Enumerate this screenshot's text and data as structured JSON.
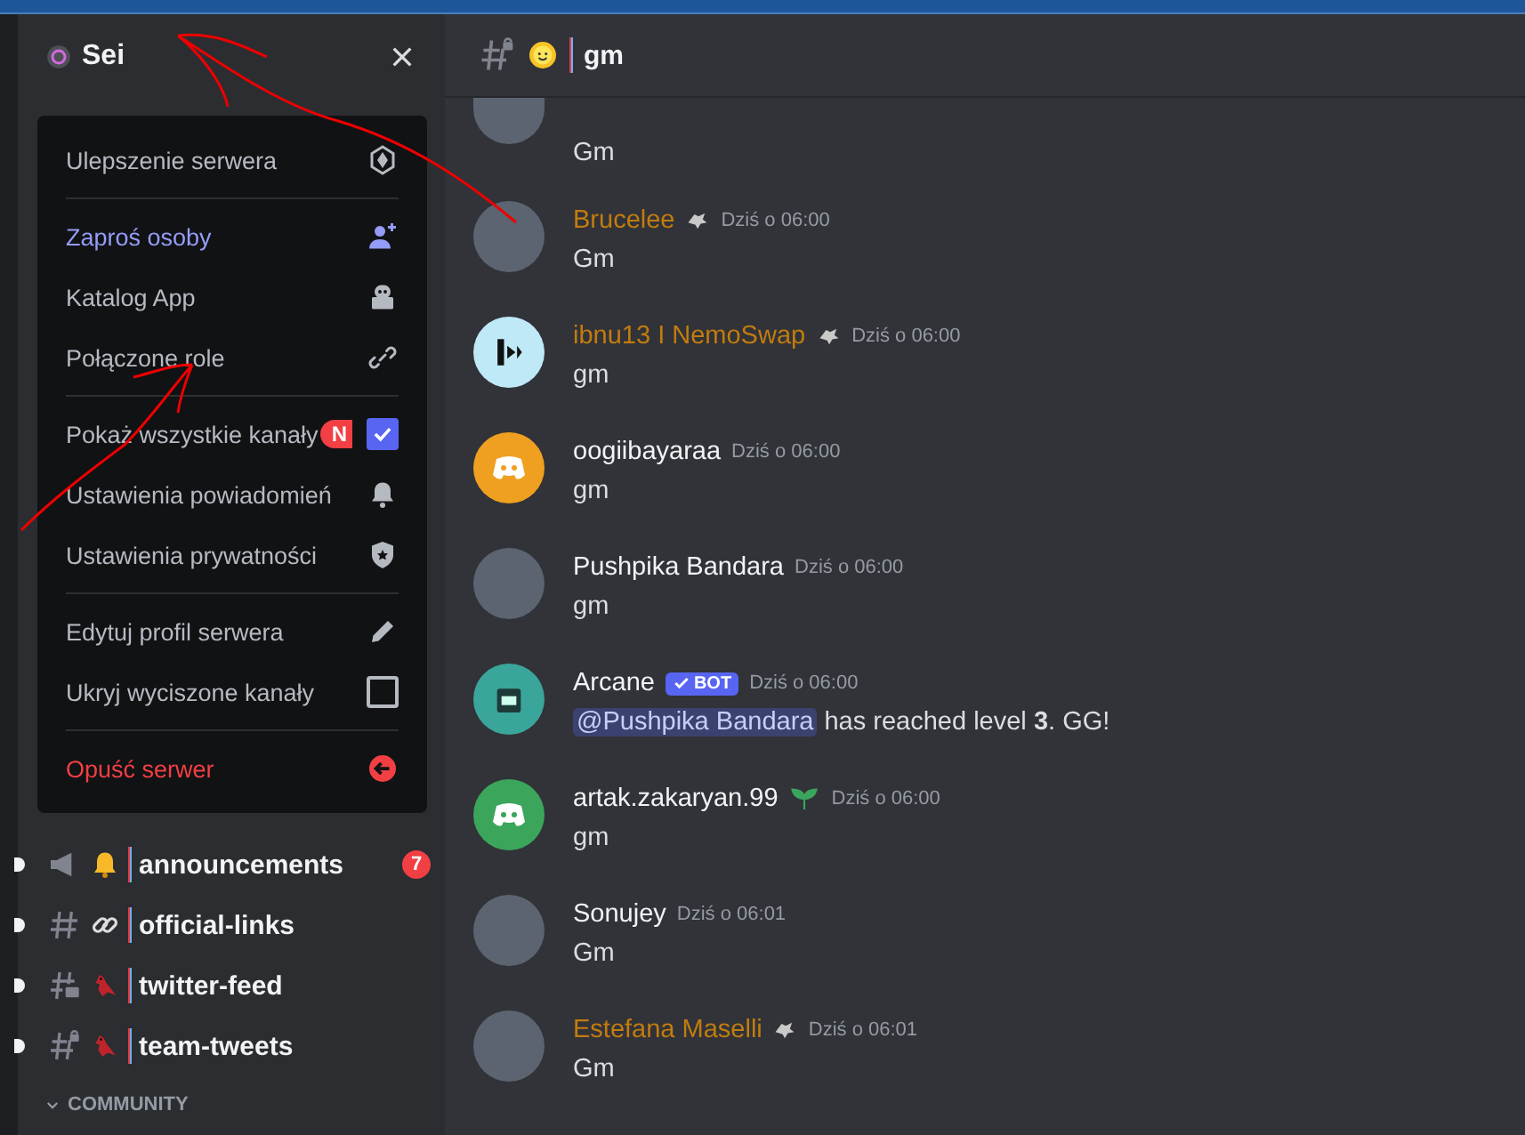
{
  "server": {
    "name": "Sei"
  },
  "menu_sections": [
    {
      "items": [
        {
          "label": "Ulepszenie serwera",
          "kind": "normal"
        }
      ]
    },
    {
      "items": [
        {
          "label": "Zaproś osoby",
          "kind": "accent"
        },
        {
          "label": "Katalog App",
          "kind": "normal"
        },
        {
          "label": "Połączone role",
          "kind": "normal"
        }
      ]
    },
    {
      "items": [
        {
          "label": "Pokaż wszystkie kanały",
          "kind": "normal",
          "checked": true,
          "badge": "N"
        },
        {
          "label": "Ustawienia powiadomień",
          "kind": "normal"
        },
        {
          "label": "Ustawienia prywatności",
          "kind": "normal"
        }
      ]
    },
    {
      "items": [
        {
          "label": "Edytuj profil serwera",
          "kind": "normal"
        },
        {
          "label": "Ukryj wyciszone kanały",
          "kind": "normal",
          "checked": false
        }
      ]
    },
    {
      "items": [
        {
          "label": "Opuść serwer",
          "kind": "danger"
        }
      ]
    }
  ],
  "channels": [
    {
      "name": "announcements",
      "kind": "announcement",
      "unread": true,
      "badge": "7"
    },
    {
      "name": "official-links",
      "kind": "text",
      "unread": true
    },
    {
      "name": "twitter-feed",
      "kind": "forum",
      "unread": true
    },
    {
      "name": "team-tweets",
      "kind": "locked",
      "unread": true
    }
  ],
  "category": {
    "name": "COMMUNITY"
  },
  "chat_header": {
    "channel": "gm",
    "kind": "locked"
  },
  "messages": [
    {
      "text": "Gm"
    },
    {
      "author": "Brucelee",
      "color": "#c27c0e",
      "kind": "role",
      "time": "Dziś o 06:00",
      "text": "Gm"
    },
    {
      "author": "ibnu13 I NemoSwap",
      "color": "#c27c0e",
      "kind": "role",
      "time": "Dziś o 06:00",
      "text": "gm"
    },
    {
      "author": "oogiibayaraa",
      "color": "#f2f3f5",
      "kind": "plain",
      "time": "Dziś o 06:00",
      "text": "gm"
    },
    {
      "author": "Pushpika Bandara",
      "color": "#f2f3f5",
      "kind": "plain",
      "time": "Dziś o 06:00",
      "text": "gm"
    },
    {
      "author": "Arcane",
      "color": "#f2f3f5",
      "kind": "bot",
      "bot_label": "BOT",
      "time": "Dziś o 06:00",
      "mention": "@Pushpika Bandara",
      "text": " has reached level **3**. GG!"
    },
    {
      "author": "artak.zakaryan.99",
      "color": "#f2f3f5",
      "kind": "sprout",
      "time": "Dziś o 06:00",
      "text": "gm"
    },
    {
      "author": "Sonujey",
      "color": "#f2f3f5",
      "kind": "plain",
      "time": "Dziś o 06:01",
      "text": "Gm"
    },
    {
      "author": "Estefana Maselli",
      "color": "#c27c0e",
      "kind": "role",
      "time": "Dziś o 06:01",
      "text": "Gm"
    }
  ]
}
